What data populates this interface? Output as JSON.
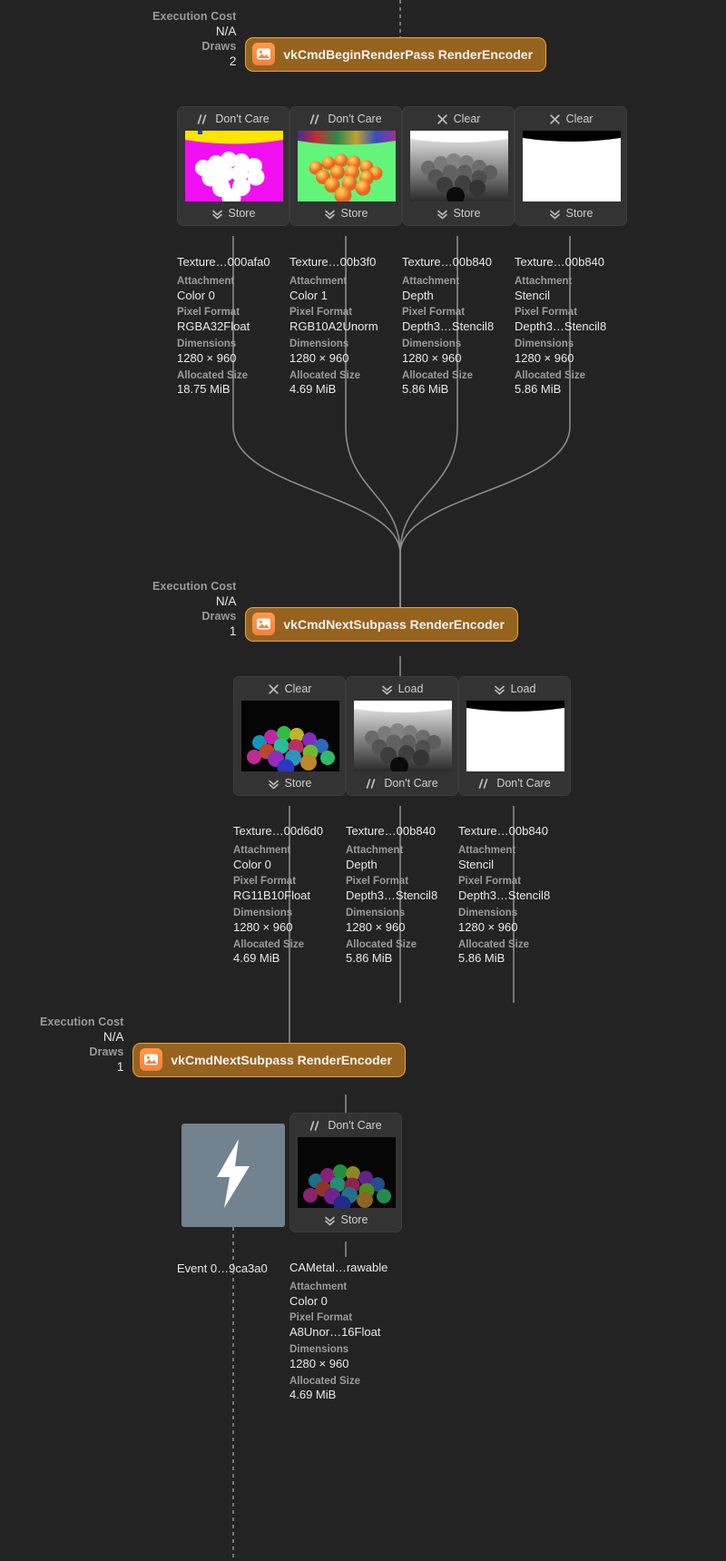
{
  "graph": {
    "background": "#232323",
    "encoder_accent": "#e8a33d",
    "encoder_fill": "#96631f",
    "icon_fill": "#f5813a",
    "event_tile_fill": "#72828e",
    "link_color": "#8a8a8a"
  },
  "labels": {
    "execution_cost": "Execution Cost",
    "draws": "Draws",
    "attachment": "Attachment",
    "pixel_format": "Pixel Format",
    "dimensions": "Dimensions",
    "allocated_size": "Allocated Size",
    "store": "Store",
    "load": "Load",
    "clear": "Clear",
    "dont_care": "Don't Care"
  },
  "encoders": [
    {
      "id": "encoder-begin-render-pass",
      "title": "vkCmdBeginRenderPass RenderEncoder",
      "execution_cost": "N/A",
      "draws": "2",
      "icon": "image-icon"
    },
    {
      "id": "encoder-next-subpass-1",
      "title": "vkCmdNextSubpass RenderEncoder",
      "execution_cost": "N/A",
      "draws": "1",
      "icon": "image-icon"
    },
    {
      "id": "encoder-next-subpass-2",
      "title": "vkCmdNextSubpass RenderEncoder",
      "execution_cost": "N/A",
      "draws": "1",
      "icon": "image-icon"
    }
  ],
  "pass1_attachments": [
    {
      "load_action": "Don't Care",
      "load_icon": "slashes-icon",
      "store_action": "Store",
      "store_icon": "chevrons-down-icon",
      "thumbnail": "magenta-spheres",
      "texture": "Texture…000afa0",
      "attachment": "Color 0",
      "pixel_format": "RGBA32Float",
      "dimensions": "1280 × 960",
      "allocated_size": "18.75 MiB"
    },
    {
      "load_action": "Don't Care",
      "load_icon": "slashes-icon",
      "store_action": "Store",
      "store_icon": "chevrons-down-icon",
      "thumbnail": "green-spheres",
      "texture": "Texture…00b3f0",
      "attachment": "Color 1",
      "pixel_format": "RGB10A2Unorm",
      "dimensions": "1280 × 960",
      "allocated_size": "4.69 MiB"
    },
    {
      "load_action": "Clear",
      "load_icon": "x-icon",
      "store_action": "Store",
      "store_icon": "chevrons-down-icon",
      "thumbnail": "depth-spheres",
      "texture": "Texture…00b840",
      "attachment": "Depth",
      "pixel_format": "Depth3…Stencil8",
      "dimensions": "1280 × 960",
      "allocated_size": "5.86 MiB"
    },
    {
      "load_action": "Clear",
      "load_icon": "x-icon",
      "store_action": "Store",
      "store_icon": "chevrons-down-icon",
      "thumbnail": "white-stencil",
      "texture": "Texture…00b840",
      "attachment": "Stencil",
      "pixel_format": "Depth3…Stencil8",
      "dimensions": "1280 × 960",
      "allocated_size": "5.86 MiB"
    }
  ],
  "pass2_attachments": [
    {
      "load_action": "Clear",
      "load_icon": "x-icon",
      "store_action": "Store",
      "store_icon": "chevrons-down-icon",
      "thumbnail": "iridescent-spheres",
      "texture": "Texture…00d6d0",
      "attachment": "Color 0",
      "pixel_format": "RG11B10Float",
      "dimensions": "1280 × 960",
      "allocated_size": "4.69 MiB"
    },
    {
      "load_action": "Load",
      "load_icon": "chevrons-down-icon",
      "store_action": "Don't Care",
      "store_icon": "slashes-icon",
      "thumbnail": "depth-spheres",
      "texture": "Texture…00b840",
      "attachment": "Depth",
      "pixel_format": "Depth3…Stencil8",
      "dimensions": "1280 × 960",
      "allocated_size": "5.86 MiB"
    },
    {
      "load_action": "Load",
      "load_icon": "chevrons-down-icon",
      "store_action": "Don't Care",
      "store_icon": "slashes-icon",
      "thumbnail": "white-stencil",
      "texture": "Texture…00b840",
      "attachment": "Stencil",
      "pixel_format": "Depth3…Stencil8",
      "dimensions": "1280 × 960",
      "allocated_size": "5.86 MiB"
    }
  ],
  "pass3": {
    "event": {
      "icon": "lightning-bolt-icon",
      "label": "Event 0…9ca3a0"
    },
    "attachment": {
      "load_action": "Don't Care",
      "load_icon": "slashes-icon",
      "store_action": "Store",
      "store_icon": "chevrons-down-icon",
      "thumbnail": "iridescent-spheres-dark",
      "texture": "CAMetal…rawable",
      "attachment": "Color 0",
      "pixel_format": "A8Unor…16Float",
      "dimensions": "1280 × 960",
      "allocated_size": "4.69 MiB"
    }
  }
}
